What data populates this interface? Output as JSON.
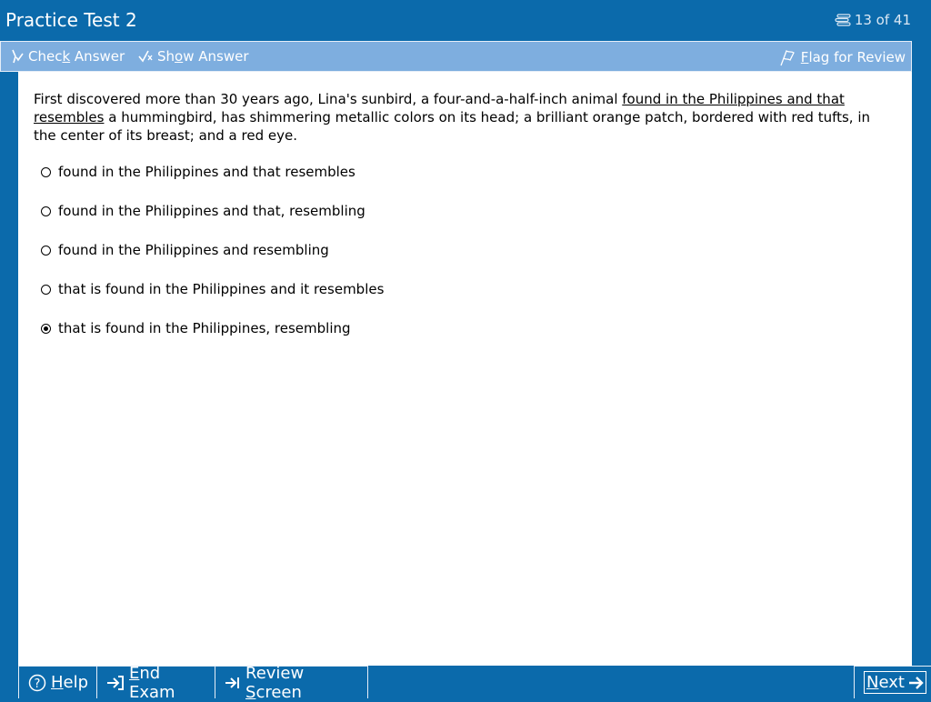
{
  "window": {
    "title": "Practice Test 2",
    "counter": "13 of 41"
  },
  "toolbar": {
    "check_answer": {
      "pre": "Chec",
      "u": "k",
      "post": " Answer"
    },
    "show_answer": {
      "pre": "Sh",
      "u": "o",
      "post": "w Answer"
    },
    "flag_review": {
      "pre": "",
      "u": "F",
      "post": "lag for Review"
    }
  },
  "question": {
    "before": "First discovered more than 30 years ago, Lina's sunbird, a four-and-a-half-inch animal ",
    "underlined": "found in the Philippines and that resembles",
    "after": " a hummingbird, has shimmering metallic colors on its head; a brilliant orange patch, bordered with red tufts, in the center of its breast; and a red eye."
  },
  "options": [
    {
      "label": "found in the Philippines and that resembles",
      "selected": false
    },
    {
      "label": "found in the Philippines and that, resembling",
      "selected": false
    },
    {
      "label": "found in the Philippines and resembling",
      "selected": false
    },
    {
      "label": "that is found in the Philippines and it resembles",
      "selected": false
    },
    {
      "label": "that is found in the Philippines, resembling",
      "selected": true
    }
  ],
  "bottom": {
    "help": {
      "u": "H",
      "post": "elp"
    },
    "end_exam": {
      "u": "E",
      "post": "nd Exam"
    },
    "review": {
      "pre": "Review ",
      "u": "S",
      "post": "creen"
    },
    "next": {
      "u": "N",
      "post": "ext"
    }
  },
  "colors": {
    "background": "#0b6aab",
    "toolbar": "#7eaedf",
    "content": "#ffffff"
  }
}
